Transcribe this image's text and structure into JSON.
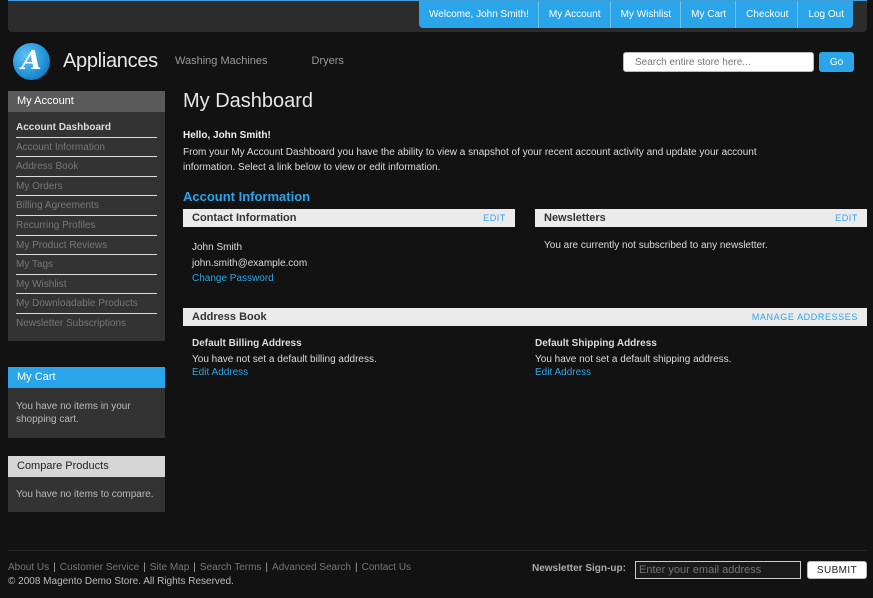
{
  "top_links": [
    "Welcome, John Smith!",
    "My Account",
    "My Wishlist",
    "My Cart",
    "Checkout",
    "Log Out"
  ],
  "header": {
    "logo_text": "Appliances",
    "logo_letter": "A",
    "nav": [
      "Washing Machines",
      "Dryers"
    ],
    "search_placeholder": "Search entire store here...",
    "search_button": "Go"
  },
  "sidebar": {
    "account_title": "My Account",
    "account_items": [
      "Account Dashboard",
      "Account Information",
      "Address Book",
      "My Orders",
      "Billing Agreements",
      "Recurring Profiles",
      "My Product Reviews",
      "My Tags",
      "My Wishlist",
      "My Downloadable Products",
      "Newsletter Subscriptions"
    ],
    "cart_title": "My Cart",
    "cart_text": "You have no items in your shopping cart.",
    "compare_title": "Compare Products",
    "compare_text": "You have no items to compare."
  },
  "main": {
    "page_title": "My Dashboard",
    "hello": "Hello, John Smith!",
    "intro": "From your My Account Dashboard you have the ability to view a snapshot of your recent account activity and update your account information. Select a link below to view or edit information.",
    "account_info_title": "Account Information",
    "contact": {
      "title": "Contact Information",
      "edit": "EDIT",
      "name": "John Smith",
      "email": "john.smith@example.com",
      "change_password": "Change Password"
    },
    "newsletters": {
      "title": "Newsletters",
      "edit": "EDIT",
      "text": "You are currently not subscribed to any newsletter."
    },
    "address_book": {
      "title": "Address Book",
      "manage": "MANAGE ADDRESSES",
      "billing_title": "Default Billing Address",
      "billing_text": "You have not set a default billing address.",
      "billing_edit": "Edit Address",
      "shipping_title": "Default Shipping Address",
      "shipping_text": "You have not set a default shipping address.",
      "shipping_edit": "Edit Address"
    }
  },
  "footer": {
    "links": [
      "About Us",
      "Customer Service",
      "Site Map",
      "Search Terms",
      "Advanced Search",
      "Contact Us"
    ],
    "separator": "|",
    "copyright": "© 2008 Magento Demo Store. All Rights Reserved.",
    "newsletter_label": "Newsletter Sign-up:",
    "newsletter_placeholder": "Enter your email address",
    "newsletter_button": "SUBMIT"
  },
  "colors": {
    "accent": "#2aa5ea",
    "background": "#121212",
    "panel": "#333333"
  }
}
